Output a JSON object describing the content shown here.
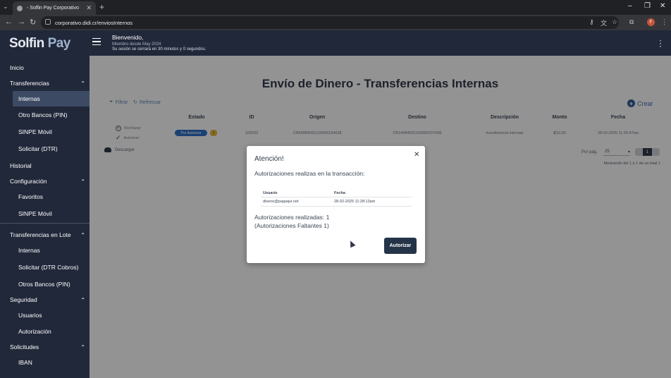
{
  "browser": {
    "tab_title": "- Solfin Pay Corporativo",
    "url": "corporativo.didi.cr/enviosInternos",
    "profile_initial": "F"
  },
  "header": {
    "logo_main": "Solfin",
    "logo_accent": "Pay",
    "welcome": "Bienvenido,",
    "member_since": "Miembro desde May 2024",
    "session_notice": "Su sesión se cerrará en 30 minutos y 0 segundos."
  },
  "sidebar": {
    "items": [
      {
        "label": "Inicio"
      },
      {
        "label": "Transferencias"
      },
      {
        "label": "Internas"
      },
      {
        "label": "Otro Bancos (PIN)"
      },
      {
        "label": "SINPE Móvil"
      },
      {
        "label": "Solicitar (DTR)"
      },
      {
        "label": "Historial"
      },
      {
        "label": "Configuración"
      },
      {
        "label": "Favoritos"
      },
      {
        "label": "SINPE Móvil"
      },
      {
        "label": "Transferencias en Lote"
      },
      {
        "label": "Internas"
      },
      {
        "label": "Solicitar (DTR Cobros)"
      },
      {
        "label": "Otros Bancos (PIN)"
      },
      {
        "label": "Seguridad"
      },
      {
        "label": "Usuarios"
      },
      {
        "label": "Autorización"
      },
      {
        "label": "Solicitudes"
      },
      {
        "label": "IBAN"
      }
    ]
  },
  "main": {
    "title": "Envío de Dinero - Transferencias Internas",
    "create_label": "Crear",
    "filter_label": "Filtrar",
    "refresh_label": "Refrescar",
    "columns": [
      "Estado",
      "ID",
      "Origen",
      "Destino",
      "Descripción",
      "Monto",
      "Fecha"
    ],
    "row": {
      "reject_label": "Rechazar",
      "authorize_label": "Autorizar",
      "status": "Por Autorizar",
      "count": "1",
      "id": "169233",
      "origin": "CR83084502120000154028",
      "destination": "CR14084502100000157696",
      "description": "transferencia internas",
      "amount": "₡10.00",
      "date": "28-02-2025 11:26:47am"
    },
    "download_label": "Descargar",
    "per_page_label": "Por pág.",
    "per_page_value": "25",
    "current_page": "1",
    "showing_text": "Mostrando del 1 a 1 de un total 1"
  },
  "modal": {
    "title": "Atención!",
    "subtitle": "Autorizaciones realizas en la transacción:",
    "columns": [
      "Usuario",
      "Fecha"
    ],
    "rows": [
      {
        "user": "diseno@pagaqui.net",
        "date": "28-02-2025 11:28:13am"
      }
    ],
    "authorizations_done": "Autorizaciones realizadas: 1",
    "authorizations_missing": "(Autorizaciones Faltantes 1)",
    "authorize_button": "Autorizar"
  }
}
